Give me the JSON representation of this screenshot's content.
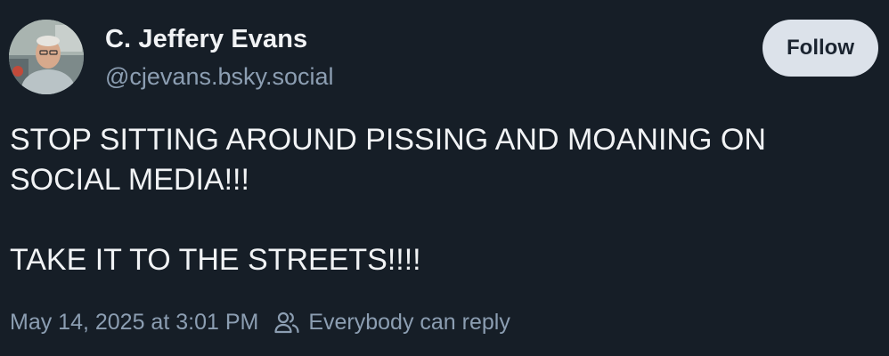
{
  "author": {
    "display_name": "C. Jeffery Evans",
    "handle": "@cjevans.bsky.social",
    "avatar_icon": "avatar-photo"
  },
  "follow_button": {
    "label": "Follow"
  },
  "post": {
    "paragraphs": [
      "STOP SITTING AROUND PISSING AND MOANING ON\nSOCIAL MEDIA!!!",
      "TAKE IT TO THE STREETS!!!!"
    ]
  },
  "meta": {
    "timestamp": "May 14, 2025 at 3:01 PM",
    "reply_setting": "Everybody can reply",
    "reply_icon": "people-icon"
  },
  "colors": {
    "background": "#161e27",
    "text": "#f1f3f5",
    "muted": "#8c9eb2",
    "button_bg": "#dce2ea"
  }
}
